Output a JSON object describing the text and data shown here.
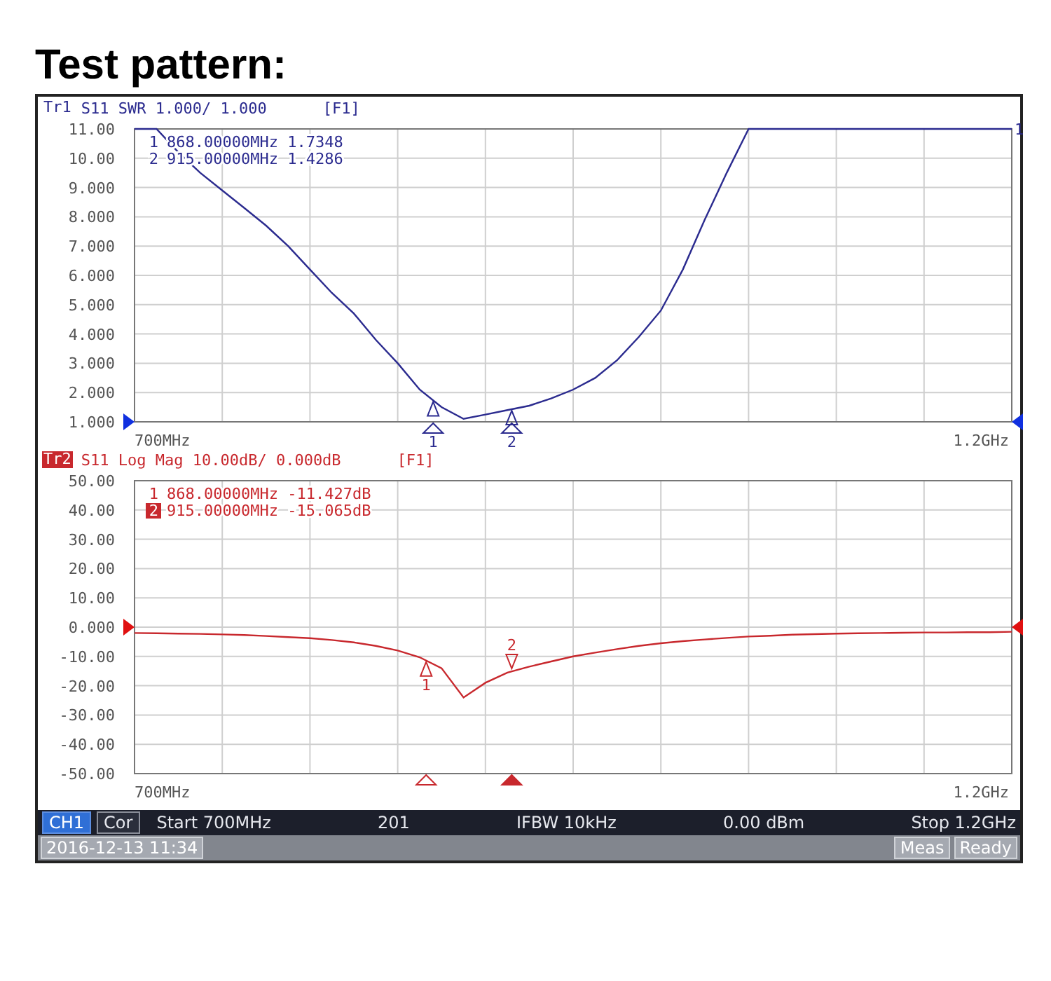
{
  "heading": "Test pattern:",
  "traces": [
    {
      "id_label": "Tr1",
      "selected": false,
      "color": "#2b2b8f",
      "params": "S11 SWR 1.000/ 1.000",
      "format_tag": "[F1]",
      "edge_label": "1",
      "start_label": "700MHz",
      "stop_label": "1.2GHz",
      "readouts": [
        {
          "number": "1",
          "text": "868.00000MHz 1.7348",
          "active": false
        },
        {
          "number": "2",
          "text": "915.00000MHz 1.4286",
          "active": false
        }
      ],
      "chart_data": {
        "type": "line",
        "categories": [
          null,
          null,
          null,
          null,
          null,
          null,
          null,
          null,
          null,
          null,
          null,
          null,
          null,
          null,
          null,
          null,
          null,
          null,
          null,
          null,
          null,
          null,
          null,
          null,
          null,
          null,
          null,
          null,
          null,
          null,
          null,
          null,
          null,
          null,
          null,
          null,
          null,
          null,
          null,
          null,
          null
        ],
        "series": [
          {
            "color": "#2b2b8f",
            "values": [
              11,
              11,
              10.2,
              9.5,
              8.9,
              8.3,
              7.7,
              7.0,
              6.2,
              5.4,
              4.7,
              3.8,
              3.0,
              2.1,
              1.5,
              1.1,
              1.25,
              1.4,
              1.55,
              1.8,
              2.1,
              2.5,
              3.1,
              3.9,
              4.8,
              6.2,
              7.9,
              9.5,
              11,
              11,
              11,
              11,
              11,
              11,
              11,
              11,
              11,
              11,
              11,
              11,
              11
            ]
          }
        ],
        "ylim": [
          1,
          11
        ],
        "yticks": [
          {
            "value": 11,
            "label": "11.00"
          },
          {
            "value": 10,
            "label": "10.00"
          },
          {
            "value": 9,
            "label": "9.000"
          },
          {
            "value": 8,
            "label": "8.000"
          },
          {
            "value": 7,
            "label": "7.000"
          },
          {
            "value": 6,
            "label": "6.000"
          },
          {
            "value": 5,
            "label": "5.000"
          },
          {
            "value": 4,
            "label": "4.000"
          },
          {
            "value": 3,
            "label": "3.000"
          },
          {
            "value": 2,
            "label": "2.000"
          },
          {
            "value": 1,
            "label": "1.000"
          }
        ],
        "grid": true,
        "annotations": [
          {
            "y": 1.73,
            "text": "1"
          },
          {
            "y": 1.43,
            "text": "2"
          }
        ]
      }
    },
    {
      "id_label": "Tr2",
      "selected": true,
      "color": "#c8282d",
      "params": "S11 Log Mag 10.00dB/ 0.000dB",
      "format_tag": "[F1]",
      "start_label": "700MHz",
      "stop_label": "1.2GHz",
      "readouts": [
        {
          "number": "1",
          "text": "868.00000MHz -11.427dB",
          "active": false
        },
        {
          "number": "2",
          "text": "915.00000MHz -15.065dB",
          "active": true
        }
      ],
      "chart_data": {
        "type": "line",
        "categories": [
          null,
          null,
          null,
          null,
          null,
          null,
          null,
          null,
          null,
          null,
          null,
          null,
          null,
          null,
          null,
          null,
          null,
          null,
          null,
          null,
          null,
          null,
          null,
          null,
          null,
          null,
          null,
          null,
          null,
          null,
          null,
          null,
          null,
          null,
          null,
          null,
          null,
          null,
          null,
          null,
          null
        ],
        "series": [
          {
            "color": "#c8282d",
            "values": [
              -2,
              -2.1,
              -2.2,
              -2.3,
              -2.5,
              -2.7,
              -3,
              -3.4,
              -3.8,
              -4.4,
              -5.2,
              -6.4,
              -8,
              -10.3,
              -14,
              -24,
              -19,
              -15.5,
              -13.5,
              -11.7,
              -10,
              -8.7,
              -7.5,
              -6.4,
              -5.5,
              -4.8,
              -4.2,
              -3.7,
              -3.2,
              -2.9,
              -2.6,
              -2.4,
              -2.2,
              -2.1,
              -2,
              -1.9,
              -1.8,
              -1.8,
              -1.7,
              -1.7,
              -1.6
            ]
          }
        ],
        "ylim": [
          -50,
          50
        ],
        "yticks": [
          {
            "value": 50,
            "label": "50.00"
          },
          {
            "value": 40,
            "label": "40.00"
          },
          {
            "value": 30,
            "label": "30.00"
          },
          {
            "value": 20,
            "label": "20.00"
          },
          {
            "value": 10,
            "label": "10.00"
          },
          {
            "value": 0,
            "label": "0.000"
          },
          {
            "value": -10,
            "label": "-10.00"
          },
          {
            "value": -20,
            "label": "-20.00"
          },
          {
            "value": -30,
            "label": "-30.00"
          },
          {
            "value": -40,
            "label": "-40.00"
          },
          {
            "value": -50,
            "label": "-50.00"
          }
        ],
        "grid": true,
        "annotations": [
          {
            "y": -11.4,
            "text": "1"
          },
          {
            "y": -15.1,
            "text": "2"
          }
        ]
      }
    }
  ],
  "status_bar": {
    "channel": {
      "label": "CH1",
      "selected": true
    },
    "correction": {
      "label": "Cor",
      "selected": false
    },
    "items": [
      "Start 700MHz",
      "201",
      "IFBW 10kHz",
      "0.00 dBm",
      "Stop 1.2GHz"
    ]
  },
  "footer": {
    "datetime": "2016-12-13 11:34",
    "buttons": [
      "Meas",
      "Ready"
    ]
  }
}
